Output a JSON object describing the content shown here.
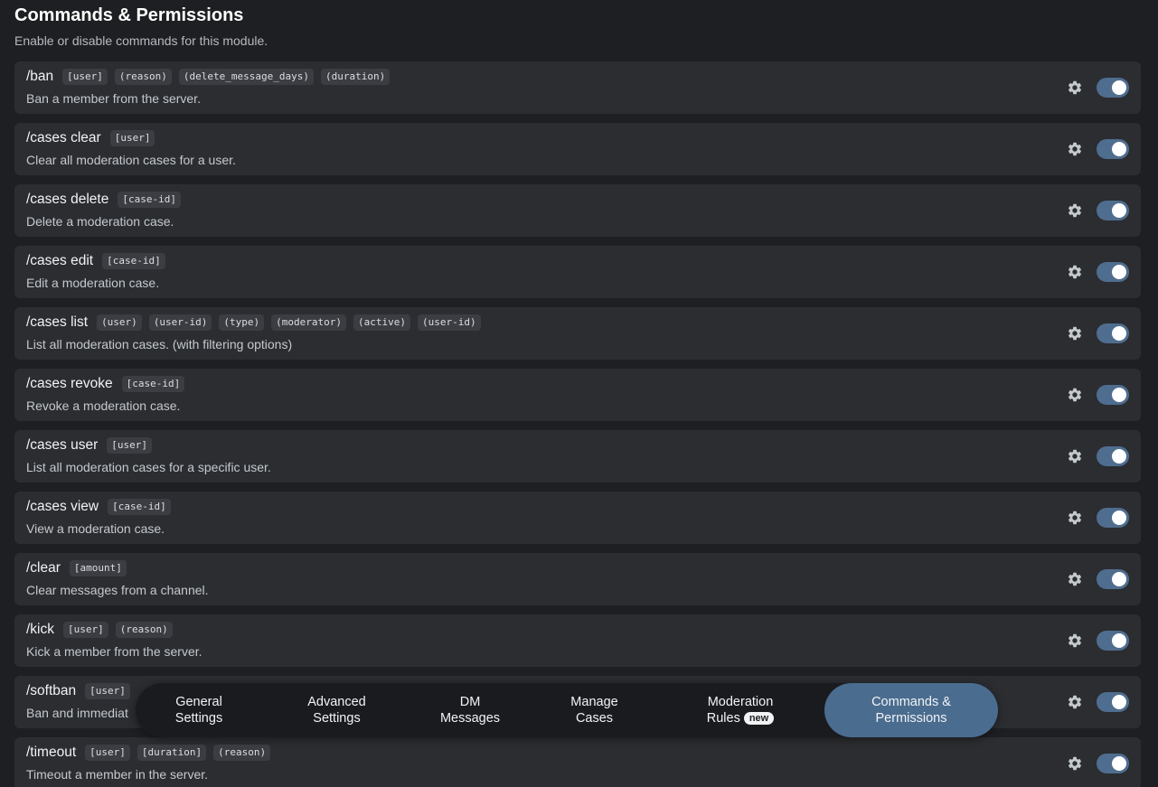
{
  "header": {
    "title": "Commands & Permissions",
    "subtitle": "Enable or disable commands for this module."
  },
  "icons": {
    "settings": "gear-icon",
    "toggle": "toggle-switch"
  },
  "colors": {
    "toggle_on": "#4f6d8f",
    "active_tab": "#4a6c8f",
    "row_bg": "#2b2d31",
    "page_bg": "#1e1f22"
  },
  "commands": [
    {
      "name": "/ban",
      "args": [
        "[user]",
        "(reason)",
        "(delete_message_days)",
        "(duration)"
      ],
      "description": "Ban a member from the server.",
      "enabled": true
    },
    {
      "name": "/cases clear",
      "args": [
        "[user]"
      ],
      "description": "Clear all moderation cases for a user.",
      "enabled": true
    },
    {
      "name": "/cases delete",
      "args": [
        "[case-id]"
      ],
      "description": "Delete a moderation case.",
      "enabled": true
    },
    {
      "name": "/cases edit",
      "args": [
        "[case-id]"
      ],
      "description": "Edit a moderation case.",
      "enabled": true
    },
    {
      "name": "/cases list",
      "args": [
        "(user)",
        "(user-id)",
        "(type)",
        "(moderator)",
        "(active)",
        "(user-id)"
      ],
      "description": "List all moderation cases. (with filtering options)",
      "enabled": true
    },
    {
      "name": "/cases revoke",
      "args": [
        "[case-id]"
      ],
      "description": "Revoke a moderation case.",
      "enabled": true
    },
    {
      "name": "/cases user",
      "args": [
        "[user]"
      ],
      "description": "List all moderation cases for a specific user.",
      "enabled": true
    },
    {
      "name": "/cases view",
      "args": [
        "[case-id]"
      ],
      "description": "View a moderation case.",
      "enabled": true
    },
    {
      "name": "/clear",
      "args": [
        "[amount]"
      ],
      "description": "Clear messages from a channel.",
      "enabled": true
    },
    {
      "name": "/kick",
      "args": [
        "[user]",
        "(reason)"
      ],
      "description": "Kick a member from the server.",
      "enabled": true
    },
    {
      "name": "/softban",
      "args": [
        "[user]"
      ],
      "description": "Ban and immediat",
      "enabled": true
    },
    {
      "name": "/timeout",
      "args": [
        "[user]",
        "[duration]",
        "(reason)"
      ],
      "description": "Timeout a member in the server.",
      "enabled": true
    }
  ],
  "tabs": [
    {
      "id": "general-settings",
      "line1": "General",
      "line2": "Settings",
      "active": false
    },
    {
      "id": "advanced-settings",
      "line1": "Advanced",
      "line2": "Settings",
      "active": false
    },
    {
      "id": "dm-messages",
      "line1": "DM",
      "line2": "Messages",
      "active": false
    },
    {
      "id": "manage-cases",
      "line1": "Manage",
      "line2": "Cases",
      "active": false
    },
    {
      "id": "moderation-rules",
      "line1": "Moderation",
      "line2": "Rules",
      "badge": "new",
      "active": false
    },
    {
      "id": "commands-permissions",
      "line1": "Commands &",
      "line2": "Permissions",
      "active": true
    }
  ]
}
